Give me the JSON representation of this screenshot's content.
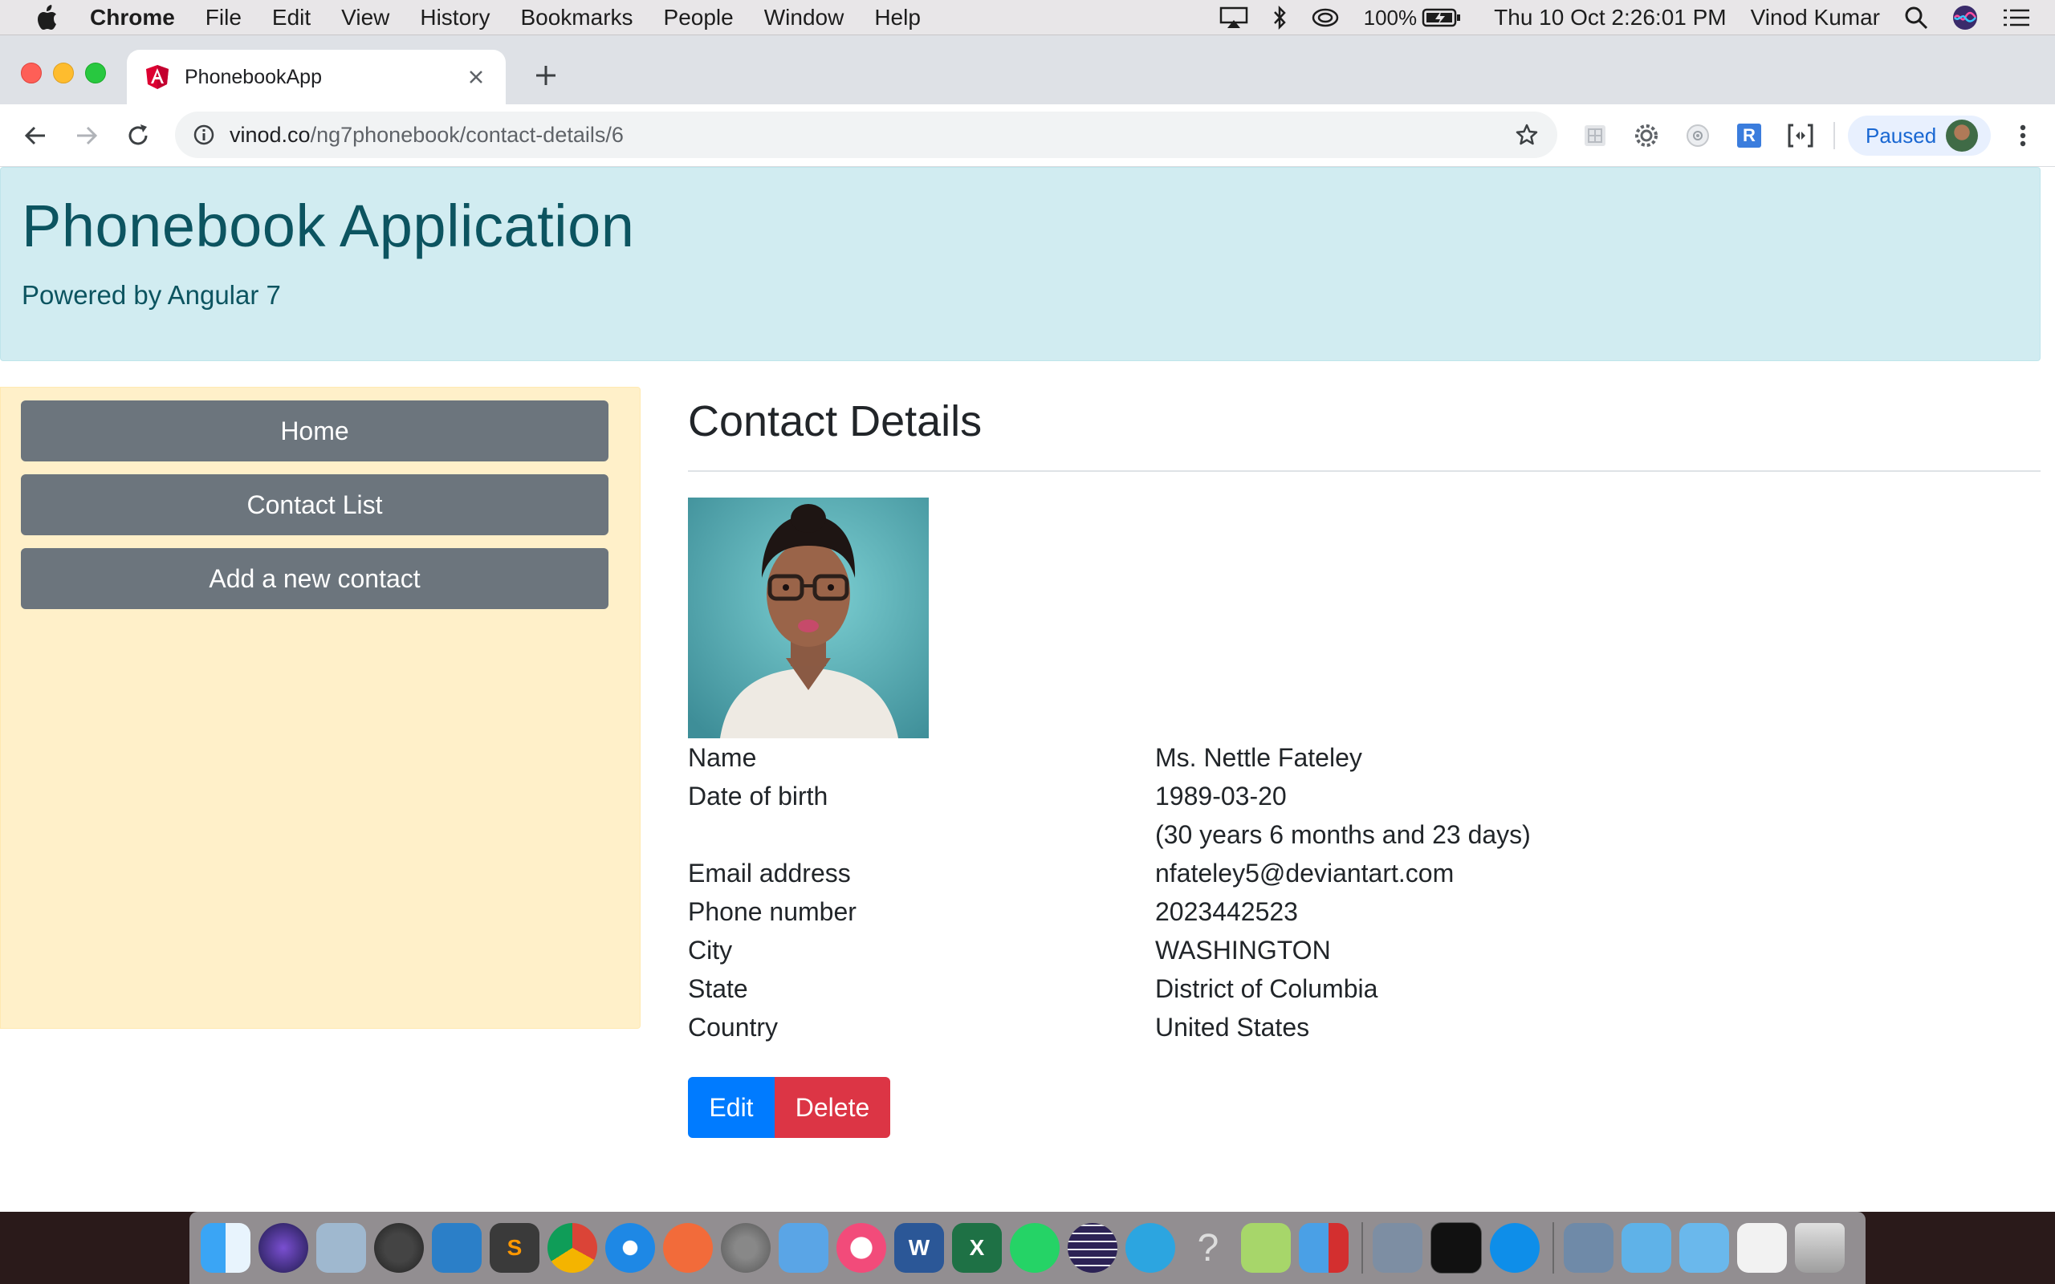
{
  "menubar": {
    "app_name": "Chrome",
    "items": [
      "File",
      "Edit",
      "View",
      "History",
      "Bookmarks",
      "People",
      "Window",
      "Help"
    ],
    "battery": "100%",
    "datetime": "Thu 10 Oct  2:26:01 PM",
    "user": "Vinod Kumar"
  },
  "browser": {
    "tab_title": "PhonebookApp",
    "url_host": "vinod.co",
    "url_path": "/ng7phonebook/contact-details/6",
    "profile_label": "Paused",
    "extension_r": "R"
  },
  "jumbotron": {
    "title": "Phonebook Application",
    "subtitle": "Powered by Angular 7"
  },
  "sidebar": {
    "items": [
      {
        "label": "Home"
      },
      {
        "label": "Contact List"
      },
      {
        "label": "Add a new contact"
      }
    ]
  },
  "contact": {
    "heading": "Contact Details",
    "fields": [
      {
        "label": "Name",
        "value": "Ms. Nettle Fateley"
      },
      {
        "label": "Date of birth",
        "value": "1989-03-20"
      },
      {
        "label": "",
        "value": "(30 years 6 months and 23 days)"
      },
      {
        "label": "Email address",
        "value": "nfateley5@deviantart.com"
      },
      {
        "label": "Phone number",
        "value": "2023442523"
      },
      {
        "label": "City",
        "value": "WASHINGTON"
      },
      {
        "label": "State",
        "value": "District of Columbia"
      },
      {
        "label": "Country",
        "value": "United States"
      }
    ],
    "edit_label": "Edit",
    "delete_label": "Delete"
  },
  "colors": {
    "jumbotron_bg": "#d1ecf1",
    "jumbotron_text": "#0c5460",
    "sidebar_bg": "#fff0c9",
    "nav_button": "#6c757d",
    "edit_button": "#007bff",
    "delete_button": "#dc3545"
  },
  "dock": {
    "icons": [
      "finder-icon",
      "siri-icon",
      "preview-icon",
      "quicktime-icon",
      "vscode-icon",
      "sublime-icon",
      "chrome-icon",
      "safari-icon",
      "compass-icon",
      "system-preferences-icon",
      "keynote-icon",
      "itunes-icon",
      "word-icon",
      "excel-icon",
      "whatsapp-icon",
      "eclipse-icon",
      "telegram-icon",
      "help-icon",
      "notes-icon",
      "parallels-icon",
      "preview-photos-icon",
      "terminal-icon",
      "teamviewer-icon",
      "folder-icon",
      "downloads-folder-icon",
      "applications-folder-icon",
      "documents-icon",
      "trash-icon"
    ]
  }
}
